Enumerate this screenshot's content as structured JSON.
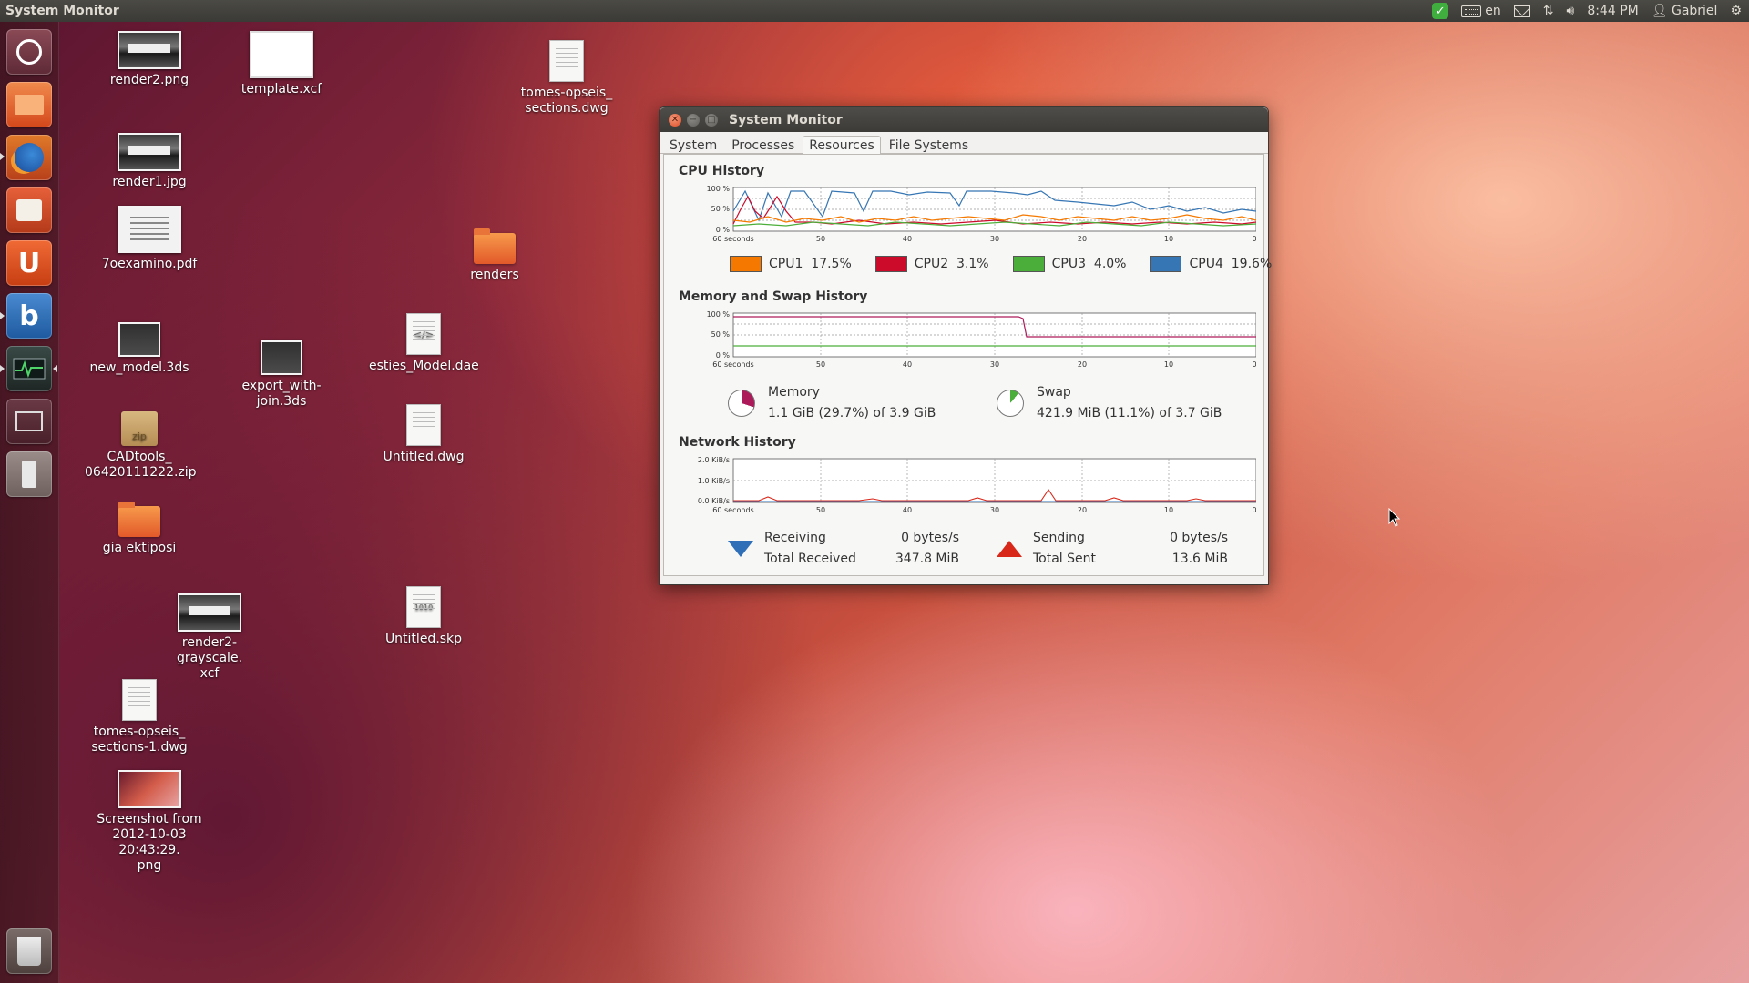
{
  "top_panel": {
    "app_title": "System Monitor",
    "keyboard_layout": "en",
    "clock": "8:44 PM",
    "user": "Gabriel"
  },
  "launcher": {
    "items": [
      {
        "name": "dash-home",
        "icon": "ubuntu-logo-icon",
        "color": "#7a3a46"
      },
      {
        "name": "files",
        "icon": "folder-icon",
        "color": "#e4622c"
      },
      {
        "name": "firefox",
        "icon": "firefox-icon",
        "color": "#2f7bc6"
      },
      {
        "name": "software-center",
        "icon": "shopping-bag-icon",
        "color": "#d5502b"
      },
      {
        "name": "ubuntu-one",
        "icon": "ubuntu-one-icon",
        "color": "#e35526"
      },
      {
        "name": "blender",
        "icon": "blender-icon",
        "color": "#2f6fb6"
      },
      {
        "name": "system-monitor",
        "icon": "monitor-icon",
        "color": "#2f3a36"
      },
      {
        "name": "workspace-switcher",
        "icon": "workspaces-icon",
        "color": "#5a2a36"
      },
      {
        "name": "usb-drive",
        "icon": "usb-icon",
        "color": "#8a7c78"
      },
      {
        "name": "trash",
        "icon": "trash-icon",
        "color": "#6a5c58"
      }
    ]
  },
  "desktop": {
    "icons": [
      {
        "label": "render2.png"
      },
      {
        "label": "template.xcf"
      },
      {
        "label": "tomes-opseis_\nsections.dwg"
      },
      {
        "label": "render1.jpg"
      },
      {
        "label": "7oexamino.pdf"
      },
      {
        "label": "renders"
      },
      {
        "label": "new_model.3ds"
      },
      {
        "label": "export_with-\njoin.3ds"
      },
      {
        "label": "esties_Model.dae"
      },
      {
        "label": "CADtools_\n06420111222.zip"
      },
      {
        "label": "Untitled.dwg"
      },
      {
        "label": "gia ektiposi"
      },
      {
        "label": "render2-grayscale.\nxcf"
      },
      {
        "label": "Untitled.skp"
      },
      {
        "label": "tomes-opseis_\nsections-1.dwg"
      },
      {
        "label": "Screenshot from\n2012-10-03 20:43:29.\npng"
      }
    ]
  },
  "window": {
    "title": "System Monitor",
    "tabs": [
      "System",
      "Processes",
      "Resources",
      "File Systems"
    ],
    "active_tab": "Resources",
    "cpu": {
      "title": "CPU History",
      "y_ticks": [
        "100 %",
        "50 %",
        "0 %"
      ],
      "x_ticks": [
        "60 seconds",
        "50",
        "40",
        "30",
        "20",
        "10",
        "0"
      ],
      "legend": [
        {
          "label": "CPU1",
          "value": "17.5%",
          "color": "#f57900"
        },
        {
          "label": "CPU2",
          "value": "3.1%",
          "color": "#cc0a2a"
        },
        {
          "label": "CPU3",
          "value": "4.0%",
          "color": "#4cae3a"
        },
        {
          "label": "CPU4",
          "value": "19.6%",
          "color": "#3676b4"
        }
      ]
    },
    "memory": {
      "title": "Memory and Swap History",
      "y_ticks": [
        "100 %",
        "50 %",
        "0 %"
      ],
      "x_ticks": [
        "60 seconds",
        "50",
        "40",
        "30",
        "20",
        "10",
        "0"
      ],
      "memory_label": "Memory",
      "memory_value": "1.1 GiB (29.7%) of 3.9 GiB",
      "memory_color": "#ad1a5a",
      "swap_label": "Swap",
      "swap_value": "421.9 MiB (11.1%) of 3.7 GiB",
      "swap_color": "#4cae3a"
    },
    "network": {
      "title": "Network History",
      "y_ticks": [
        "2.0 KiB/s",
        "1.0 KiB/s",
        "0.0 KiB/s"
      ],
      "x_ticks": [
        "60 seconds",
        "50",
        "40",
        "30",
        "20",
        "10",
        "0"
      ],
      "receiving_label": "Receiving",
      "receiving_value": "0 bytes/s",
      "total_received_label": "Total Received",
      "total_received_value": "347.8 MiB",
      "sending_label": "Sending",
      "sending_value": "0 bytes/s",
      "total_sent_label": "Total Sent",
      "total_sent_value": "13.6 MiB"
    }
  }
}
